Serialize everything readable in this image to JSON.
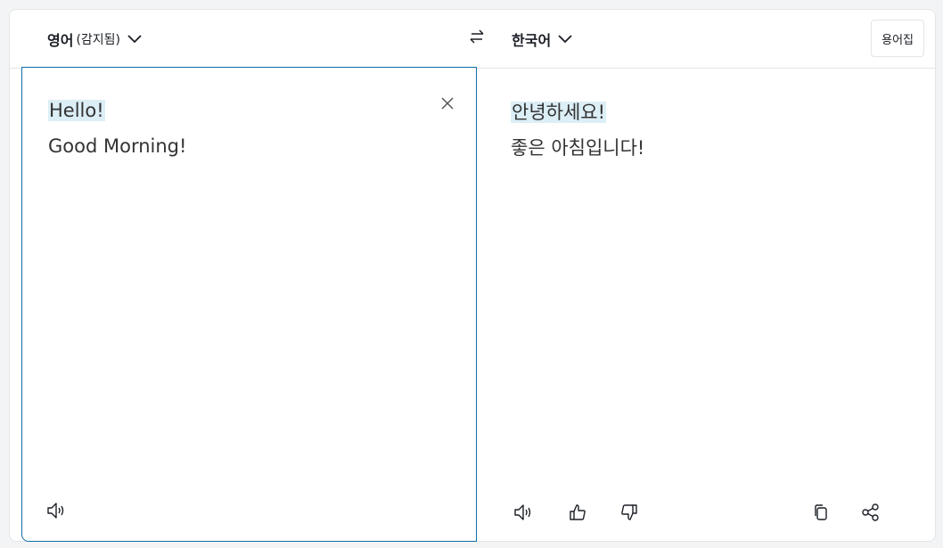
{
  "header": {
    "source_language": "영어",
    "source_detected": "(감지됨)",
    "target_language": "한국어",
    "glossary_label": "용어집"
  },
  "source": {
    "line1": "Hello!",
    "line2": "Good Morning!"
  },
  "target": {
    "line1": "안녕하세요!",
    "line2": "좋은 아침입니다!"
  },
  "colors": {
    "accent_border": "#0f6fa8",
    "highlight": "#dceef6",
    "divider": "#e3e5e8"
  },
  "icons": [
    "chevron-down-icon",
    "swap-icon",
    "close-icon",
    "speaker-icon",
    "thumbs-up-icon",
    "thumbs-down-icon",
    "copy-icon",
    "share-icon"
  ]
}
